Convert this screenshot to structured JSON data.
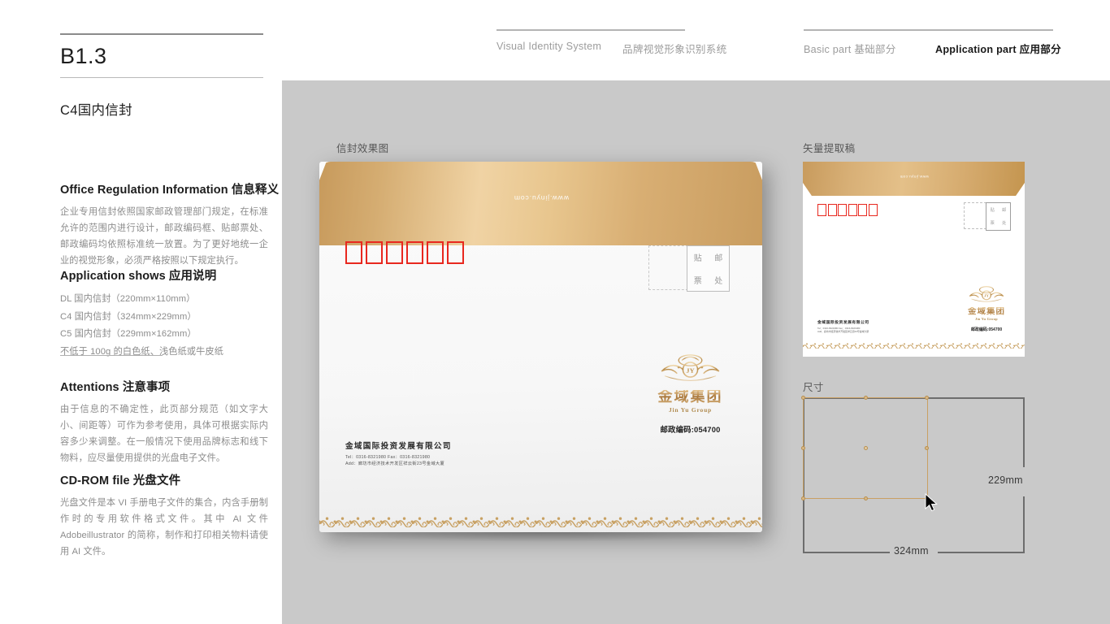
{
  "header": {
    "left_primary": "Visual Identity System",
    "left_secondary": "品牌视觉形象识别系统",
    "right_basic": "Basic part  基础部分",
    "right_application": "Application part  应用部分"
  },
  "sidebar": {
    "code": "B1.3",
    "subtitle": "C4国内信封",
    "sections": [
      {
        "title": "Office Regulation Information 信息释义",
        "body": "企业专用信封依照国家邮政管理部门规定，在标准允许的范围内进行设计，邮政编码框、贴邮票处、邮政编码均依照标准统一放置。为了更好地统一企业的视觉形象，必须严格按照以下规定执行。"
      },
      {
        "title": "Application shows 应用说明",
        "specs": [
          "DL 国内信封（220mm×110mm）",
          "C4 国内信封（324mm×229mm）",
          "C5 国内信封（229mm×162mm）",
          "不低于 100g 的白色纸、浅色纸或牛皮纸"
        ]
      },
      {
        "title": "Attentions 注意事项",
        "body": "由于信息的不确定性，此页部分规范（如文字大小、间距等）可作为参考使用，具体可根据实际内容多少来调整。在一般情况下使用品牌标志和线下物料，应尽量使用提供的光盘电子文件。"
      },
      {
        "title": "CD-ROM file 光盘文件",
        "body": "光盘文件是本 VI 手册电子文件的集合，内含手册制作时的专用软件格式文件。其中 AI 文件 Adobeillustrator 的简称，制作和打印相关物料请使用 AI 文件。"
      }
    ]
  },
  "canvas": {
    "label_mockup": "信封效果图",
    "label_vector": "矢量提取稿",
    "label_size": "尺寸"
  },
  "envelope": {
    "flap_url": "www.jinyu.com",
    "postal_cells": 6,
    "stamp_chars": [
      "贴",
      "邮",
      "票",
      "处"
    ],
    "company_name": "金域国际投资发展有限公司",
    "contact_line": "Tel：0316-8321980     Fax：0316-8321980",
    "address_line": "Add：廊坊市经济技术开发区祥云街23号金域大厦",
    "logo_cn": "金域集团",
    "logo_en": "Jin Yu Group",
    "zip_label": "邮政编码:054700",
    "accent_gold": "#c99d60",
    "postal_box_color": "#e8281f"
  },
  "size_diagram": {
    "width_label": "324mm",
    "height_label": "229mm"
  }
}
